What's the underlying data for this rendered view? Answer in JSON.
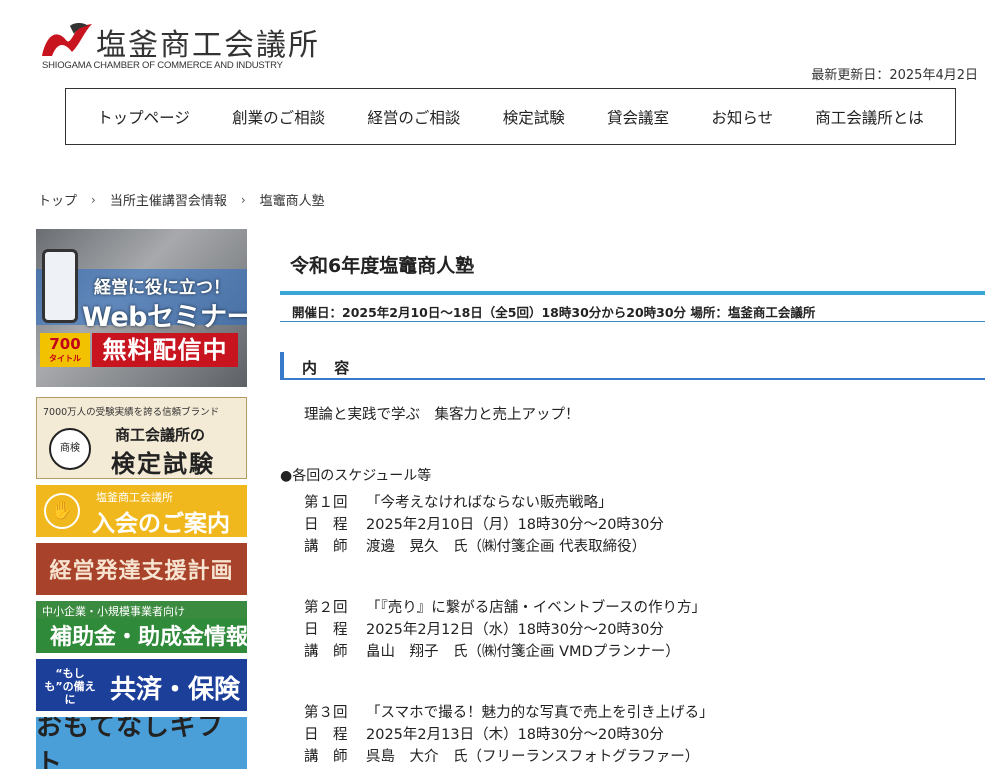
{
  "header": {
    "org_name": "塩釜商工会議所",
    "org_name_en": "SHIOGAMA CHAMBER OF COMMERCE AND INDUSTRY",
    "updated": "最新更新日：2025年4月2日"
  },
  "nav": [
    "トップページ",
    "創業のご相談",
    "経営のご相談",
    "検定試験",
    "貸会議室",
    "お知らせ",
    "商工会議所とは"
  ],
  "breadcrumb": [
    "トップ",
    "当所主催講習会情報",
    "塩竈商人塾"
  ],
  "breadcrumb_sep": "›",
  "sidebar": {
    "web": {
      "line1": "経営に役に立つ！",
      "line2": "Webセミナー",
      "badge_num": "700",
      "badge_unit": "タイトル",
      "free": "無料配信中"
    },
    "kentei": {
      "top": "7000万人の受験実績を誇る信頼ブランド",
      "logo": "商検",
      "line1": "商工会議所の",
      "line2": "検定試験"
    },
    "join": {
      "sub": "塩釜商工会議所",
      "main": "入会のご案内"
    },
    "plan": "経営発達支援計画",
    "subsidy": {
      "sub": "中小企業・小規模事業者向け",
      "main": "補助金・助成金情報"
    },
    "insurance": {
      "sub": "“もしも”の備えに",
      "main": "共済・保険"
    },
    "gift": "おもてなしギフト"
  },
  "main": {
    "title": "令和6年度塩竈商人塾",
    "date_line": "開催日：2025年2月10日〜18日（全5回）18時30分から20時30分 場所：塩釜商工会議所",
    "section": "内 容",
    "lead": "理論と実践で学ぶ　集客力と売上アップ！",
    "schedule_title": "●各回のスケジュール等",
    "sessions": [
      {
        "num": "第１回",
        "title": "「今考えなければならない販売戦略」",
        "date_label": "日　程",
        "date": "2025年2月10日（月）18時30分〜20時30分",
        "lecturer_label": "講　師",
        "lecturer": "渡邊　晃久　氏（㈱付箋企画 代表取締役）"
      },
      {
        "num": "第２回",
        "title": "「『売り』に繋がる店舗・イベントブースの作り方」",
        "date_label": "日　程",
        "date": "2025年2月12日（水）18時30分〜20時30分",
        "lecturer_label": "講　師",
        "lecturer": "畠山　翔子　氏（㈱付箋企画 VMDプランナー）"
      },
      {
        "num": "第３回",
        "title": "「スマホで撮る！魅力的な写真で売上を引き上げる」",
        "date_label": "日　程",
        "date": "2025年2月13日（木）18時30分〜20時30分",
        "lecturer_label": "講　師",
        "lecturer": "呉島　大介　氏（フリーランスフォトグラファー）"
      }
    ]
  },
  "colors": {
    "accent_blue": "#39a7d4",
    "section_blue": "#3a7acb",
    "logo_red": "#c7141f"
  }
}
